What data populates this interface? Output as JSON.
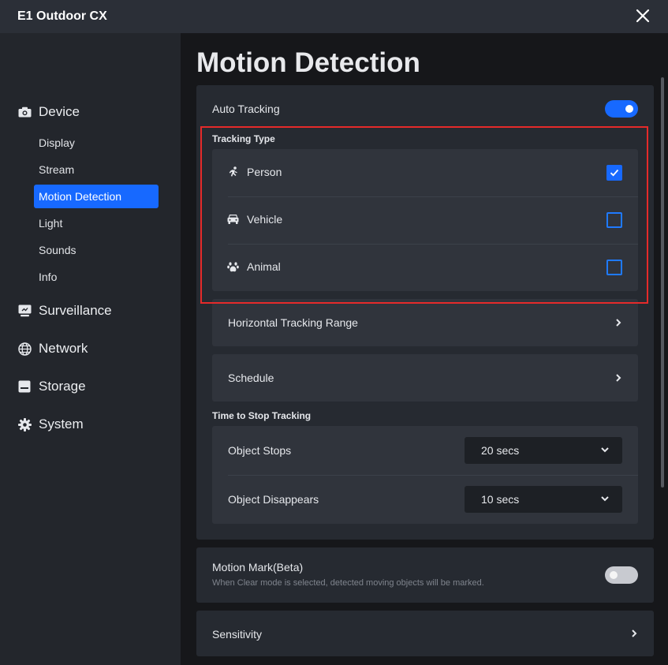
{
  "window": {
    "title": "E1 Outdoor CX"
  },
  "sidebar": {
    "groups": [
      {
        "label": "Device",
        "icon": "camera-icon"
      },
      {
        "label": "Surveillance",
        "icon": "monitor-icon"
      },
      {
        "label": "Network",
        "icon": "globe-icon"
      },
      {
        "label": "Storage",
        "icon": "storage-icon"
      },
      {
        "label": "System",
        "icon": "gear-icon"
      }
    ],
    "device_items": [
      "Display",
      "Stream",
      "Motion Detection",
      "Light",
      "Sounds",
      "Info"
    ],
    "active_item": "Motion Detection"
  },
  "page": {
    "title": "Motion Detection",
    "auto_tracking": {
      "label": "Auto Tracking",
      "enabled": true
    },
    "tracking_type": {
      "label": "Tracking Type",
      "options": [
        {
          "label": "Person",
          "icon": "running-person-icon",
          "checked": true
        },
        {
          "label": "Vehicle",
          "icon": "car-icon",
          "checked": false
        },
        {
          "label": "Animal",
          "icon": "paw-icon",
          "checked": false
        }
      ]
    },
    "horizontal_tracking_range": {
      "label": "Horizontal Tracking Range"
    },
    "schedule": {
      "label": "Schedule"
    },
    "time_to_stop": {
      "label": "Time to Stop Tracking",
      "object_stops": {
        "label": "Object Stops",
        "value": "20 secs"
      },
      "object_disappears": {
        "label": "Object Disappears",
        "value": "10 secs"
      }
    },
    "motion_mark": {
      "label": "Motion Mark(Beta)",
      "description": "When Clear mode is selected, detected moving objects will be marked.",
      "enabled": false
    },
    "sensitivity": {
      "label": "Sensitivity"
    }
  },
  "colors": {
    "accent": "#1769ff",
    "highlight_border": "#e52a2a",
    "panel": "#262a31",
    "card": "#30343c"
  }
}
